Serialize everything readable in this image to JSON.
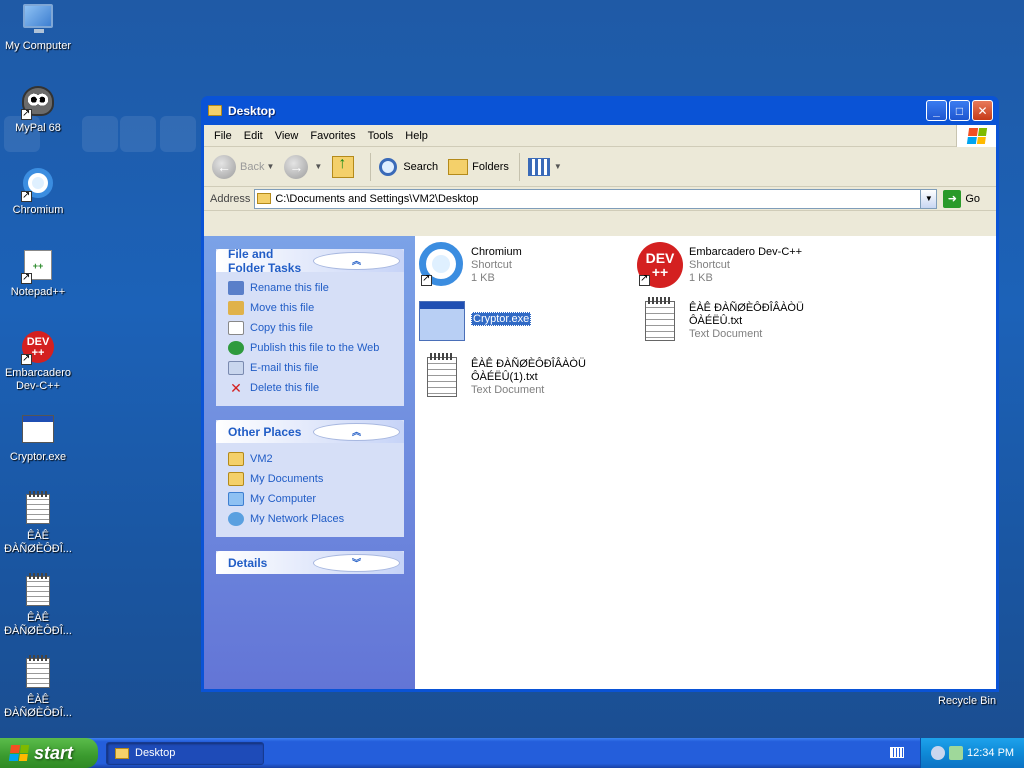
{
  "desktop": {
    "icons": [
      {
        "label": "My Computer",
        "icon": "computer-icon"
      },
      {
        "label": "MyPal 68",
        "icon": "raccoon-browser-icon"
      },
      {
        "label": "Chromium",
        "icon": "chromium-icon"
      },
      {
        "label": "Notepad++",
        "icon": "notepad-plus-plus-icon"
      },
      {
        "label": "Embarcadero Dev-C++",
        "icon": "devcpp-icon"
      },
      {
        "label": "Cryptor.exe",
        "icon": "exe-window-icon"
      },
      {
        "label": "ÊÀÊ ÐÀÑØÈÔÐÎ...",
        "icon": "text-document-icon"
      },
      {
        "label": "ÊÀÊ ÐÀÑØÈÔÐÎ...",
        "icon": "text-document-icon"
      },
      {
        "label": "ÊÀÊ ÐÀÑØÈÔÐÎ...",
        "icon": "text-document-icon"
      }
    ],
    "recycle_bin": "Recycle Bin"
  },
  "window": {
    "title": "Desktop",
    "menu": [
      "File",
      "Edit",
      "View",
      "Favorites",
      "Tools",
      "Help"
    ],
    "toolbar": {
      "back": "Back",
      "search": "Search",
      "folders": "Folders"
    },
    "address": {
      "label": "Address",
      "value": "C:\\Documents and Settings\\VM2\\Desktop",
      "go": "Go"
    },
    "file_tasks": {
      "title": "File and Folder Tasks",
      "items": [
        "Rename this file",
        "Move this file",
        "Copy this file",
        "Publish this file to the Web",
        "E-mail this file",
        "Delete this file"
      ]
    },
    "other_places": {
      "title": "Other Places",
      "items": [
        "VM2",
        "My Documents",
        "My Computer",
        "My Network Places"
      ]
    },
    "details": {
      "title": "Details"
    },
    "files": [
      {
        "name": "Chromium",
        "type": "Shortcut",
        "size": "1 KB",
        "icon": "chromium-icon"
      },
      {
        "name": "Embarcadero Dev-C++",
        "type": "Shortcut",
        "size": "1 KB",
        "icon": "devcpp-icon"
      },
      {
        "name": "Cryptor.exe",
        "type": "",
        "size": "",
        "icon": "exe-window-icon",
        "selected": true
      },
      {
        "name": "ÊÀÊ ÐÀÑØÈÔÐÎÂÀÒÜ",
        "name2": "ÔÀÉËÛ.txt",
        "type": "Text Document",
        "icon": "text-document-icon"
      },
      {
        "name": "ÊÀÊ ÐÀÑØÈÔÐÎÂÀÒÜ",
        "name2": "ÔÀÉËÛ(1).txt",
        "type": "Text Document",
        "icon": "text-document-icon"
      }
    ]
  },
  "taskbar": {
    "start": "start",
    "active_task": "Desktop",
    "clock": "12:34 PM"
  }
}
